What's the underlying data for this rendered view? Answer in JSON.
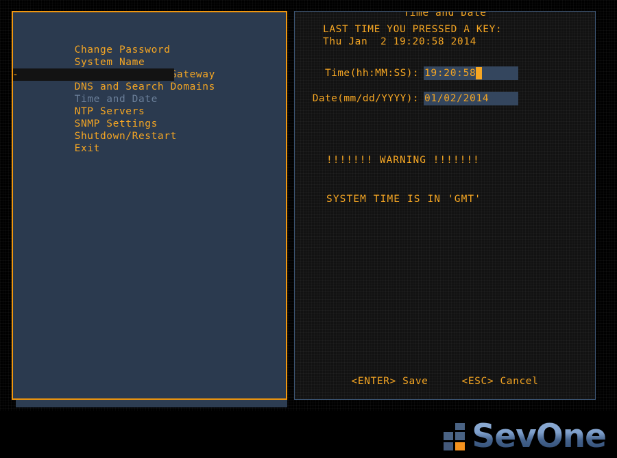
{
  "screen": {
    "accent_orange": "#f5a623",
    "panel_blue": "#2b3a4f",
    "field_blue": "#34465e",
    "dark_bg": "#121212"
  },
  "menu": {
    "items": [
      {
        "label": "Change Password",
        "marker": "",
        "selected": false
      },
      {
        "label": "System Name",
        "marker": "",
        "selected": false
      },
      {
        "label": "IP Address and Gateway",
        "marker": "",
        "selected": false
      },
      {
        "label": "DNS and Search Domains",
        "marker": "",
        "selected": false
      },
      {
        "label": "Time and Date",
        "marker": "-",
        "selected": true
      },
      {
        "label": "NTP Servers",
        "marker": "",
        "selected": false
      },
      {
        "label": "SNMP Settings",
        "marker": "",
        "selected": false
      },
      {
        "label": "Shutdown/Restart",
        "marker": "",
        "selected": false
      },
      {
        "label": "Exit",
        "marker": "",
        "selected": false
      }
    ]
  },
  "form": {
    "title": "Time and Date",
    "last_key_label": "LAST TIME YOU PRESSED A KEY:",
    "last_key_value": "Thu Jan  2 19:20:58 2014",
    "fields": [
      {
        "label": "Time(hh:MM:SS):",
        "value": "19:20:58",
        "has_cursor": true
      },
      {
        "label": "Date(mm/dd/YYYY):",
        "value": "01/02/2014",
        "has_cursor": false
      }
    ],
    "warning_line1": "!!!!!!! WARNING !!!!!!!",
    "warning_line2": "SYSTEM TIME IS IN 'GMT'",
    "actions": [
      {
        "label": "<ENTER> Save"
      },
      {
        "label": "<ESC> Cancel"
      }
    ]
  },
  "branding": {
    "product_name": "SevOne",
    "mark_cells": [
      "empty",
      "blue",
      "blue",
      "blue",
      "blue",
      "orange"
    ]
  }
}
